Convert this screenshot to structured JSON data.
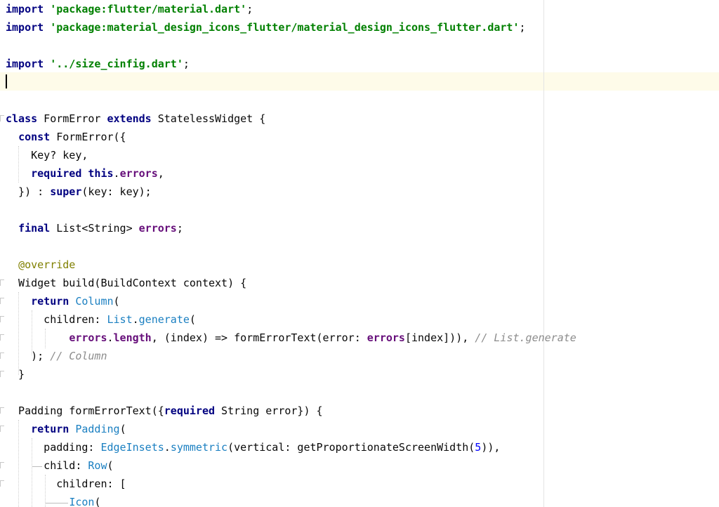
{
  "editor": {
    "language": "dart",
    "current_line_index": 4,
    "lines": [
      [
        {
          "t": "import",
          "s": "kw"
        },
        {
          "t": " ",
          "s": "plain"
        },
        {
          "t": "'package:flutter/material.dart'",
          "s": "str"
        },
        {
          "t": ";",
          "s": "plain"
        }
      ],
      [
        {
          "t": "import",
          "s": "kw"
        },
        {
          "t": " ",
          "s": "plain"
        },
        {
          "t": "'package:material_design_icons_flutter/material_design_icons_flutter.dart'",
          "s": "str"
        },
        {
          "t": ";",
          "s": "plain"
        }
      ],
      [],
      [
        {
          "t": "import",
          "s": "kw"
        },
        {
          "t": " ",
          "s": "plain"
        },
        {
          "t": "'../size_cinfig.dart'",
          "s": "str"
        },
        {
          "t": ";",
          "s": "plain"
        }
      ],
      [],
      [],
      [
        {
          "t": "class",
          "s": "kw"
        },
        {
          "t": " FormError ",
          "s": "plain"
        },
        {
          "t": "extends",
          "s": "kw"
        },
        {
          "t": " StatelessWidget {",
          "s": "plain"
        }
      ],
      [
        {
          "t": "  ",
          "s": "plain"
        },
        {
          "t": "const",
          "s": "kw"
        },
        {
          "t": " FormError({",
          "s": "plain"
        }
      ],
      [
        {
          "t": "    Key? key,",
          "s": "plain"
        }
      ],
      [
        {
          "t": "    ",
          "s": "plain"
        },
        {
          "t": "required",
          "s": "kw"
        },
        {
          "t": " ",
          "s": "plain"
        },
        {
          "t": "this",
          "s": "kw"
        },
        {
          "t": ".",
          "s": "plain"
        },
        {
          "t": "errors",
          "s": "fld"
        },
        {
          "t": ",",
          "s": "plain"
        }
      ],
      [
        {
          "t": "  }) : ",
          "s": "plain"
        },
        {
          "t": "super",
          "s": "kw"
        },
        {
          "t": "(key: key);",
          "s": "plain"
        }
      ],
      [],
      [
        {
          "t": "  ",
          "s": "plain"
        },
        {
          "t": "final",
          "s": "kw"
        },
        {
          "t": " List<String> ",
          "s": "plain"
        },
        {
          "t": "errors",
          "s": "fld"
        },
        {
          "t": ";",
          "s": "plain"
        }
      ],
      [],
      [
        {
          "t": "  ",
          "s": "plain"
        },
        {
          "t": "@override",
          "s": "ann"
        }
      ],
      [
        {
          "t": "  Widget build(BuildContext context) {",
          "s": "plain"
        }
      ],
      [
        {
          "t": "    ",
          "s": "plain"
        },
        {
          "t": "return",
          "s": "kw"
        },
        {
          "t": " ",
          "s": "plain"
        },
        {
          "t": "Column",
          "s": "cls"
        },
        {
          "t": "(",
          "s": "plain"
        }
      ],
      [
        {
          "t": "      children: ",
          "s": "plain"
        },
        {
          "t": "List",
          "s": "cls"
        },
        {
          "t": ".",
          "s": "plain"
        },
        {
          "t": "generate",
          "s": "cls"
        },
        {
          "t": "(",
          "s": "plain"
        }
      ],
      [
        {
          "t": "          ",
          "s": "plain"
        },
        {
          "t": "errors",
          "s": "fld"
        },
        {
          "t": ".",
          "s": "plain"
        },
        {
          "t": "length",
          "s": "fld"
        },
        {
          "t": ", (index) => formErrorText(error: ",
          "s": "plain"
        },
        {
          "t": "errors",
          "s": "fld"
        },
        {
          "t": "[index])), ",
          "s": "plain"
        },
        {
          "t": "// List.generate",
          "s": "cmt"
        }
      ],
      [
        {
          "t": "    ); ",
          "s": "plain"
        },
        {
          "t": "// Column",
          "s": "cmt"
        }
      ],
      [
        {
          "t": "  }",
          "s": "plain"
        }
      ],
      [],
      [
        {
          "t": "  Padding formErrorText({",
          "s": "plain"
        },
        {
          "t": "required",
          "s": "kw"
        },
        {
          "t": " String error}) {",
          "s": "plain"
        }
      ],
      [
        {
          "t": "    ",
          "s": "plain"
        },
        {
          "t": "return",
          "s": "kw"
        },
        {
          "t": " ",
          "s": "plain"
        },
        {
          "t": "Padding",
          "s": "cls"
        },
        {
          "t": "(",
          "s": "plain"
        }
      ],
      [
        {
          "t": "      padding: ",
          "s": "plain"
        },
        {
          "t": "EdgeInsets",
          "s": "cls"
        },
        {
          "t": ".",
          "s": "plain"
        },
        {
          "t": "symmetric",
          "s": "cls"
        },
        {
          "t": "(vertical: getProportionateScreenWidth(",
          "s": "plain"
        },
        {
          "t": "5",
          "s": "num"
        },
        {
          "t": ")),",
          "s": "plain"
        }
      ],
      [
        {
          "t": "      child: ",
          "s": "plain"
        },
        {
          "t": "Row",
          "s": "cls"
        },
        {
          "t": "(",
          "s": "plain"
        }
      ],
      [
        {
          "t": "        children: [",
          "s": "plain"
        }
      ],
      [
        {
          "t": "          ",
          "s": "plain"
        },
        {
          "t": "Icon",
          "s": "cls"
        },
        {
          "t": "(",
          "s": "plain"
        }
      ]
    ]
  },
  "colors": {
    "keyword": "#000080",
    "string": "#008000",
    "field": "#660e7a",
    "class_ref": "#1a7fc1",
    "number": "#0000ff",
    "comment": "#8c8c8c",
    "annotation": "#808000",
    "current_line_bg": "#fefbe9"
  }
}
